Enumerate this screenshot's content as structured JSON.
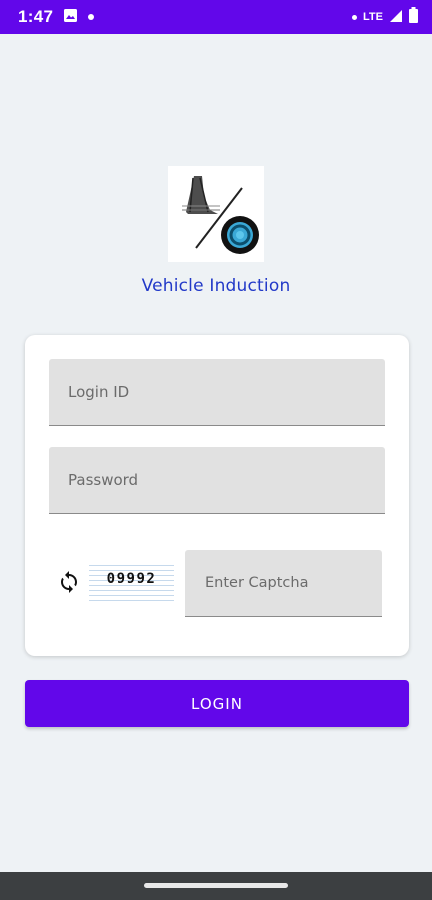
{
  "status_bar": {
    "time": "1:47",
    "network": "LTE",
    "background_color": "#6207ea"
  },
  "app": {
    "title": "Vehicle Induction",
    "title_color": "#2239c8"
  },
  "form": {
    "login_id": {
      "placeholder": "Login ID",
      "value": ""
    },
    "password": {
      "placeholder": "Password",
      "value": ""
    },
    "captcha": {
      "code": "09992",
      "input_placeholder": "Enter Captcha",
      "input_value": ""
    }
  },
  "actions": {
    "login_label": "LOGIN",
    "accent_color": "#6207ea"
  },
  "icons": {
    "image_notification": "image-icon",
    "refresh": "refresh-icon",
    "signal": "signal-icon",
    "battery": "battery-icon"
  }
}
